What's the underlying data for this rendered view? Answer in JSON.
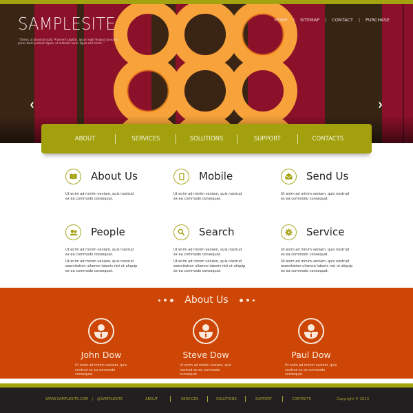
{
  "site": {
    "logo": "SAMPLESITE",
    "tagline_open": "“",
    "tagline": "Donec ut placerat nulla. Praesent sagittis, ipsum eget feugiat convallis, purus diam pretium ligula, ut molestie lacus ligula sed lorem.",
    "tagline_close": "”"
  },
  "top_nav": [
    "HOME",
    "SITEMAP",
    "CONTACT",
    "PURCHASE"
  ],
  "top_nav_separator": "|",
  "slider": {
    "prev_icon": "‹",
    "next_icon": "›"
  },
  "main_nav": [
    "ABOUT",
    "SERVICES",
    "SOLUTIONS",
    "SUPPORT",
    "CONTACTS"
  ],
  "features": [
    {
      "title": "About Us",
      "icon": "book-icon",
      "texts": [
        "Ut enim ad minim veniam, quis nostrud ex ea commodo consequat."
      ]
    },
    {
      "title": "Mobile",
      "icon": "mobile-icon",
      "texts": [
        "Ut enim ad minim veniam, quis nostrud ex ea commodo consequat."
      ]
    },
    {
      "title": "Send Us",
      "icon": "envelope-icon",
      "texts": [
        "Ut enim ad minim veniam, quis nostrud ex ea commodo consequat."
      ]
    },
    {
      "title": "People",
      "icon": "people-icon",
      "texts": [
        "Ut enim ad minim veniam, quis nostrud ex ea commodo consequat.",
        "Ut enim ad minim veniam, quis nostrud exercitation ullamco laboris nisi ut aliquip ex ea commodo consequat."
      ]
    },
    {
      "title": "Search",
      "icon": "search-icon",
      "texts": [
        "Ut enim ad minim veniam, quis nostrud ex ea commodo consequat.",
        "Ut enim ad minim veniam, quis nostrud exercitation ullamco laboris nisi ut aliquip ex ea commodo consequat."
      ]
    },
    {
      "title": "Service",
      "icon": "gear-icon",
      "texts": [
        "Ut enim ad minim veniam, quis nostrud ex ea commodo consequat.",
        "Ut enim ad minim veniam, quis nostrud exercitation ullamco laboris nisi ut aliquip ex ea commodo consequat."
      ]
    }
  ],
  "about_section": {
    "title": "About Us",
    "members": [
      {
        "name": "John Dow",
        "text": "Ut enim ad minim veniam, quis nostrud ex ea commodo consequat."
      },
      {
        "name": "Steve Dow",
        "text": "Ut enim ad minim veniam, quis nostrud ex ea commodo consequat."
      },
      {
        "name": "Paul Dow",
        "text": "Ut enim ad minim veniam, quis nostrud ex ea commodo consequat."
      }
    ]
  },
  "footer": {
    "website": "WWW.SAMPLESITE.COM",
    "separator": "|",
    "handle": "@SAMPLESITE",
    "links": [
      "ABOUT",
      "SERVICES",
      "SOLUTIONS",
      "SUPPORT",
      "CONTACTS"
    ],
    "copyright": "Copyright © 2013"
  },
  "colors": {
    "olive": "#a3a20f",
    "crimson": "#8b1029",
    "dark_brown": "#3a2515",
    "ring_orange": "#f7a23a",
    "about_orange": "#cd4606",
    "footer_bg": "#231f20"
  }
}
